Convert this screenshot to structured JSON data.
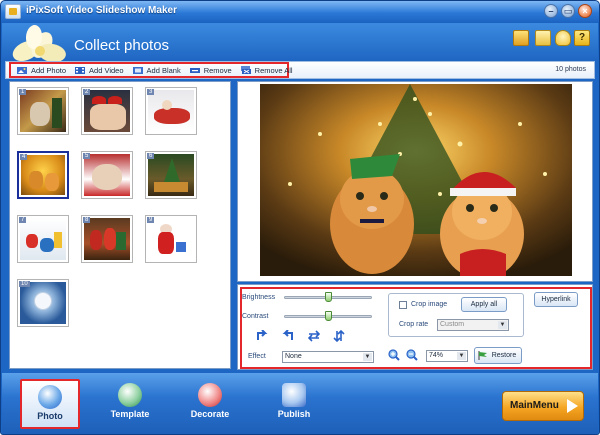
{
  "window": {
    "title": "iPixSoft Video Slideshow Maker",
    "minimize_icon": "minimize-icon",
    "restore_icon": "restore-icon",
    "close_icon": "close-icon"
  },
  "header": {
    "title": "Collect photos",
    "icons": [
      "folder-icon",
      "notes-icon",
      "lightbulb-icon",
      "help-icon"
    ]
  },
  "toolbar": {
    "buttons": [
      {
        "label": "Add Photo",
        "icon": "add-photo-icon"
      },
      {
        "label": "Add Video",
        "icon": "add-video-icon"
      },
      {
        "label": "Add Blank",
        "icon": "add-blank-icon"
      },
      {
        "label": "Remove",
        "icon": "remove-icon"
      },
      {
        "label": "Remove All",
        "icon": "remove-all-icon"
      }
    ],
    "photo_count": "10 photos"
  },
  "thumbnails": [
    {
      "num": "1"
    },
    {
      "num": "2"
    },
    {
      "num": "3"
    },
    {
      "num": "4",
      "selected": true
    },
    {
      "num": "5"
    },
    {
      "num": "6"
    },
    {
      "num": "7"
    },
    {
      "num": "8"
    },
    {
      "num": "9"
    },
    {
      "num": "10"
    }
  ],
  "controls": {
    "brightness_label": "Brightness",
    "brightness_value": 0.5,
    "contrast_label": "Contrast",
    "contrast_value": 0.5,
    "effect_label": "Effect",
    "effect_value": "None",
    "crop_image_label": "Crop image",
    "crop_image_checked": false,
    "apply_all_label": "Apply all",
    "crop_rate_label": "Crop rate",
    "crop_rate_value": "Custom",
    "hyperlink_label": "Hyperlink",
    "zoom_value": "74%",
    "restore_label": "Restore"
  },
  "bottom_nav": {
    "items": [
      {
        "label": "Photo",
        "active": true
      },
      {
        "label": "Template",
        "active": false
      },
      {
        "label": "Decorate",
        "active": false
      },
      {
        "label": "Publish",
        "active": false
      }
    ],
    "main_menu_label": "MainMenu"
  },
  "colors": {
    "accent_blue": "#1d66c4",
    "highlight_red": "#e4272a",
    "main_menu_orange": "#f5a623"
  }
}
